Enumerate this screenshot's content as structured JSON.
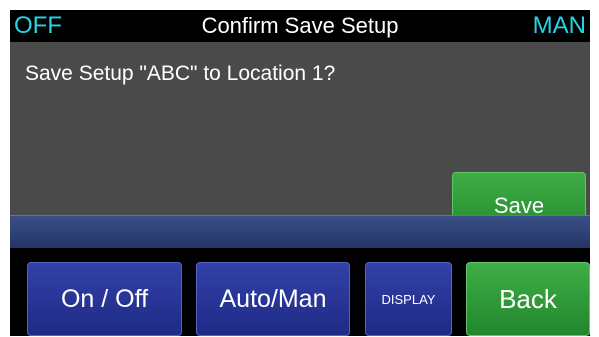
{
  "status": {
    "left": "OFF",
    "title": "Confirm Save Setup",
    "right": "MAN"
  },
  "dialog": {
    "message": "Save Setup \"ABC\" to Location 1?",
    "save_label": "Save"
  },
  "buttons": {
    "on_off": "On / Off",
    "auto_man": "Auto/Man",
    "display": "DISPLAY",
    "back": "Back"
  },
  "colors": {
    "status_accent": "#28d2e6",
    "dialog_background": "#4a4a4a",
    "button_blue": "#2836a0",
    "button_green": "#2f9e39"
  }
}
